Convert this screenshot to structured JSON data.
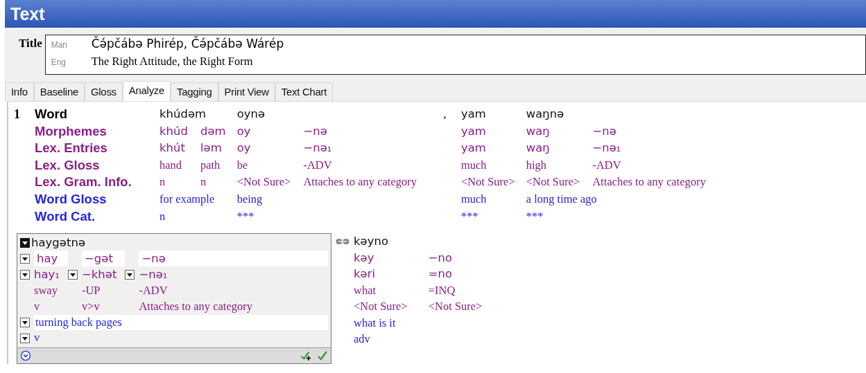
{
  "header": {
    "title": "Text"
  },
  "title_field": {
    "label": "Title",
    "lines": [
      {
        "ws": "Man",
        "text": "Čə́pčábə Phirép, Čə́pčábə Wárép",
        "kind": "vern"
      },
      {
        "ws": "Eng",
        "text": "The Right Attitude, the Right Form",
        "kind": "analysis"
      }
    ]
  },
  "tabs": [
    {
      "label": "Info",
      "selected": false
    },
    {
      "label": "Baseline",
      "selected": false
    },
    {
      "label": "Gloss",
      "selected": false
    },
    {
      "label": "Analyze",
      "selected": true
    },
    {
      "label": "Tagging",
      "selected": false
    },
    {
      "label": "Print View",
      "selected": false
    },
    {
      "label": "Text Chart",
      "selected": false
    }
  ],
  "segment": {
    "number": "1",
    "row_labels": [
      {
        "text": "Word",
        "kind": "word"
      },
      {
        "text": "Morphemes",
        "kind": "morph"
      },
      {
        "text": "Lex. Entries",
        "kind": "morph"
      },
      {
        "text": "Lex. Gloss",
        "kind": "morph"
      },
      {
        "text": "Lex. Gram. Info.",
        "kind": "morph"
      },
      {
        "text": "Word Gloss",
        "kind": "gloss"
      },
      {
        "text": "Word Cat.",
        "kind": "gloss"
      }
    ],
    "bundles": [
      {
        "kind": "word",
        "word": "khúdəm",
        "morphemes": [
          {
            "form": "khúd",
            "entry": "khút",
            "gloss": "hand",
            "gram": "n"
          },
          {
            "form": "dəm",
            "entry": "ləm",
            "gloss": "path",
            "gram": "n"
          }
        ],
        "word_gloss": "for example",
        "word_cat": "n"
      },
      {
        "kind": "word",
        "word": "oynə",
        "morphemes": [
          {
            "form": "oy",
            "entry": "oy",
            "gloss": "be",
            "gram": "<Not Sure>"
          },
          {
            "form": "−nə",
            "entry": "−nə₁",
            "gloss": "-ADV",
            "gram": "Attaches to any category"
          }
        ],
        "word_gloss": "being",
        "word_cat": "***"
      },
      {
        "kind": "punct",
        "word": ","
      },
      {
        "kind": "word",
        "word": "yam",
        "morphemes": [
          {
            "form": "yam",
            "entry": "yam",
            "gloss": "much",
            "gram": "<Not Sure>"
          }
        ],
        "word_gloss": "much",
        "word_cat": "***"
      },
      {
        "kind": "word",
        "word": "waŋnə",
        "morphemes": [
          {
            "form": "waŋ",
            "entry": "waŋ",
            "gloss": "high",
            "gram": "<Not Sure>"
          },
          {
            "form": "−nə",
            "entry": "−nə₁",
            "gloss": "-ADV",
            "gram": "Attaches to any category"
          }
        ],
        "word_gloss": "a long time ago",
        "word_cat": "***"
      }
    ]
  },
  "sandbox": {
    "word": "haygətnə",
    "morphemes": [
      {
        "form": "hay",
        "entry": "hay₁",
        "gloss": "sway",
        "gram": "v"
      },
      {
        "form": "−gət",
        "entry": "−khət",
        "gloss": "-UP",
        "gram": "v>v"
      },
      {
        "form": "−nə",
        "entry": "−nə₁",
        "gloss": "-ADV",
        "gram": "Attaches to any category"
      }
    ],
    "word_gloss": "turning back pages",
    "word_cat": "v"
  },
  "next_bundle": {
    "word": "kəyno",
    "morphemes": [
      {
        "form": "kəy",
        "entry": "kəri",
        "gloss": "what",
        "gram": "<Not Sure>"
      },
      {
        "form": "−no",
        "entry": "=no",
        "gloss": "=INQ",
        "gram": "<Not Sure>"
      }
    ],
    "word_gloss": "what is it",
    "word_cat": "adv"
  }
}
